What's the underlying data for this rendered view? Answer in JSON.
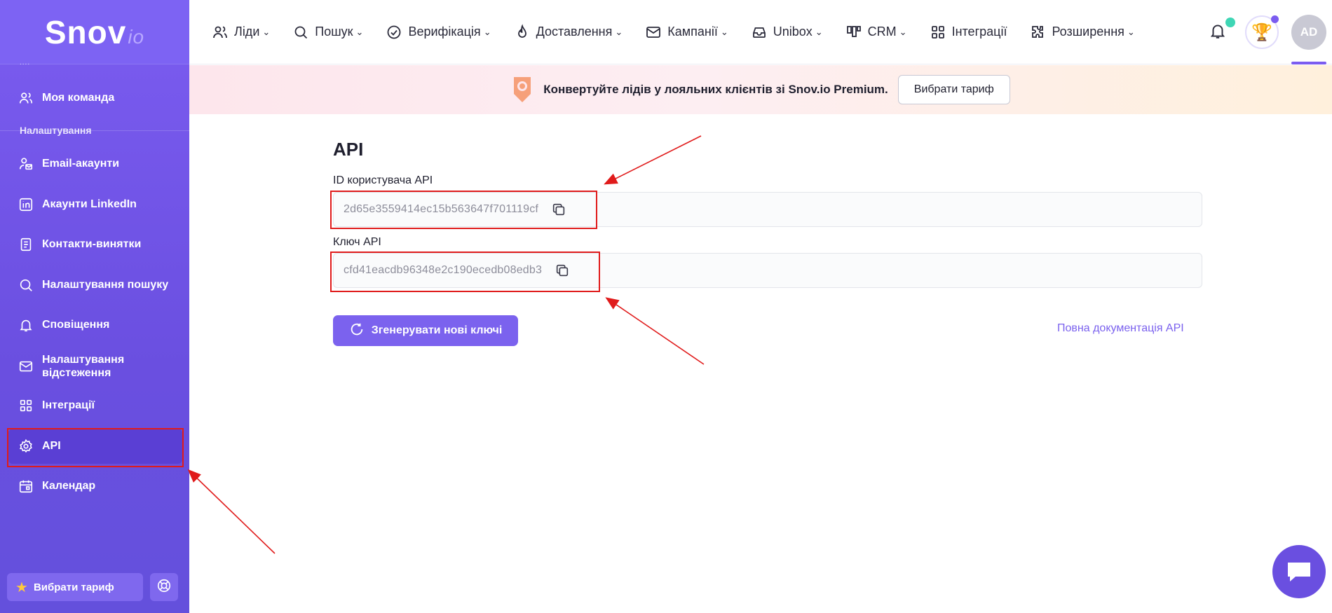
{
  "app": {
    "logo_main": "Snov",
    "logo_suffix": "io"
  },
  "sidebar": {
    "dots": "....",
    "my_team": "Моя команда",
    "section_settings": "Налаштування",
    "items": [
      {
        "label": "Email-акаунти",
        "icon": "user-mail-icon"
      },
      {
        "label": "Акаунти LinkedIn",
        "icon": "linkedin-icon"
      },
      {
        "label": "Контакти-винятки",
        "icon": "document-list-icon"
      },
      {
        "label": "Налаштування пошуку",
        "icon": "search-icon"
      },
      {
        "label": "Сповіщення",
        "icon": "bell-icon"
      },
      {
        "label_line1": "Налаштування",
        "label_line2": "відстеження",
        "icon": "mail-tracking-icon"
      },
      {
        "label": "Інтеграції",
        "icon": "grid-icon"
      },
      {
        "label": "API",
        "icon": "gear-icon",
        "active": true
      },
      {
        "label": "Календар",
        "icon": "calendar-icon"
      }
    ],
    "plan_button": "Вибрати тариф"
  },
  "topnav": {
    "items": [
      {
        "label": "Ліди",
        "icon": "users-icon",
        "dropdown": true
      },
      {
        "label": "Пошук",
        "icon": "search-icon",
        "dropdown": true
      },
      {
        "label": "Верифікація",
        "icon": "check-circle-icon",
        "dropdown": true
      },
      {
        "label": "Доставлення",
        "icon": "flame-icon",
        "dropdown": true
      },
      {
        "label": "Кампанії",
        "icon": "envelope-icon",
        "dropdown": true
      },
      {
        "label": "Unibox",
        "icon": "inbox-icon",
        "dropdown": true
      },
      {
        "label": "CRM",
        "icon": "columns-icon",
        "dropdown": true
      },
      {
        "label": "Інтеграції",
        "icon": "grid-icon",
        "dropdown": false
      },
      {
        "label": "Розширення",
        "icon": "puzzle-icon",
        "dropdown": true
      }
    ],
    "avatar_initials": "AD"
  },
  "banner": {
    "text": "Конвертуйте лідів у лояльних клієнтів зі Snov.io Premium.",
    "button": "Вибрати тариф"
  },
  "main": {
    "title": "API",
    "user_id_label": "ID користувача API",
    "user_id_value": "2d65e3559414ec15b563647f701119cf",
    "api_key_label": "Ключ API",
    "api_key_value": "cfd41eacdb96348e2c190ecedb08edb3",
    "generate_button": "Згенерувати нові ключі",
    "docs_link": "Повна документація API"
  },
  "colors": {
    "accent": "#7b62ee",
    "sidebar": "#6a4fe0",
    "highlight": "#e01b1b",
    "notification_dot": "#3fd6b5"
  }
}
